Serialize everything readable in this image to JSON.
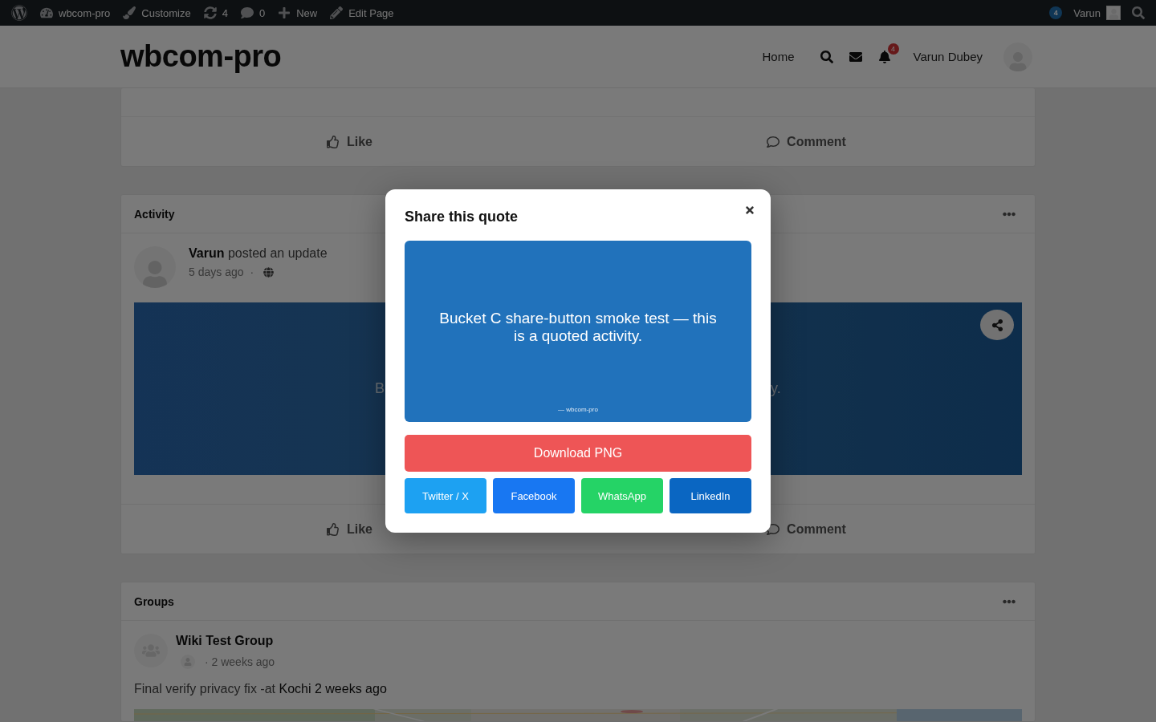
{
  "admin_bar": {
    "items": [
      {
        "kind": "logo"
      },
      {
        "kind": "site",
        "label": "wbcom-pro"
      },
      {
        "kind": "customize",
        "label": "Customize"
      },
      {
        "kind": "updates",
        "label": "4"
      },
      {
        "kind": "comments",
        "label": "0"
      },
      {
        "kind": "new",
        "label": "New"
      },
      {
        "kind": "edit",
        "label": "Edit Page"
      }
    ],
    "notification_count": "4",
    "user": "Varun"
  },
  "header": {
    "site_title": "wbcom-pro",
    "nav": [
      {
        "label": "Home"
      }
    ],
    "notification_count": "4",
    "user_name": "Varun Dubey"
  },
  "feed": {
    "first_card": {
      "actions": [
        {
          "kind": "like",
          "label": "Like"
        },
        {
          "kind": "comment",
          "label": "Comment"
        }
      ]
    },
    "activity": {
      "title": "Activity",
      "post": "**Varun** posted an update",
      "time": "5 days ago",
      "separator": "·",
      "quote_left": "B",
      "quote_right": "y.",
      "actions": [
        {
          "kind": "like",
          "label": "Like"
        },
        {
          "kind": "comment",
          "label": "Comment"
        }
      ]
    },
    "groups": {
      "title": "Groups",
      "group_name": "Wiki Test Group",
      "time": "· 2 weeks ago",
      "text": "Final verify privacy fix -at",
      "link": "Kochi 2 weeks ago"
    }
  },
  "modal": {
    "title": "Share this quote",
    "quote": "Bucket C share-button smoke test — this is a quoted activity.",
    "attribution": "— wbcom-pro",
    "download": "Download PNG",
    "share": [
      {
        "label": "Twitter / X",
        "color": "#1da1f2"
      },
      {
        "label": "Facebook",
        "color": "#1877f2"
      },
      {
        "label": "WhatsApp",
        "color": "#25d366"
      },
      {
        "label": "LinkedIn",
        "color": "#0a66c2"
      }
    ]
  }
}
